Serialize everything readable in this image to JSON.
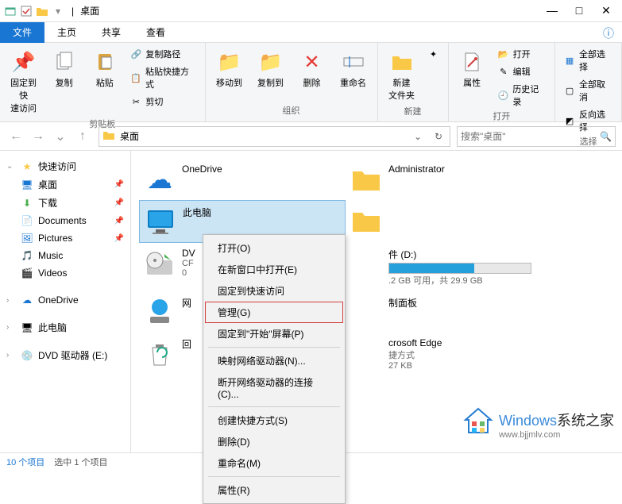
{
  "titlebar": {
    "separator": "|",
    "title": "桌面"
  },
  "win": {
    "min": "—",
    "max": "□",
    "close": "✕"
  },
  "tabs": {
    "file": "文件",
    "home": "主页",
    "share": "共享",
    "view": "查看"
  },
  "ribbon": {
    "clipboard": {
      "pin": "固定到快\n速访问",
      "copy": "复制",
      "paste": "粘贴",
      "copy_path": "复制路径",
      "paste_shortcut": "粘贴快捷方式",
      "cut": "剪切",
      "label": "剪贴板"
    },
    "organize": {
      "move": "移动到",
      "copy_to": "复制到",
      "delete": "删除",
      "rename": "重命名",
      "label": "组织"
    },
    "new": {
      "new_folder": "新建\n文件夹",
      "label": "新建"
    },
    "open": {
      "properties": "属性",
      "open": "打开",
      "edit": "编辑",
      "history": "历史记录",
      "label": "打开"
    },
    "select": {
      "select_all": "全部选择",
      "select_none": "全部取消",
      "invert": "反向选择",
      "label": "选择"
    }
  },
  "address": {
    "location": "桌面"
  },
  "search": {
    "placeholder": "搜索\"桌面\""
  },
  "sidebar": {
    "quick_access": "快速访问",
    "desktop": "桌面",
    "downloads": "下载",
    "documents": "Documents",
    "pictures": "Pictures",
    "music": "Music",
    "videos": "Videos",
    "onedrive": "OneDrive",
    "this_pc": "此电脑",
    "dvd": "DVD 驱动器 (E:)"
  },
  "items": {
    "onedrive": "OneDrive",
    "admin": "Administrator",
    "this_pc": "此电脑",
    "dvd1": "DV",
    "dvd2": "CF",
    "dvd3": "0",
    "disk_name": "件 (D:)",
    "disk_sub": ".2 GB 可用，共 29.9 GB",
    "network": "网",
    "panel_name": "制面板",
    "recycle": "回",
    "edge_name": "crosoft Edge",
    "edge_sub1": "捷方式",
    "edge_sub2": "27 KB"
  },
  "context": {
    "open": "打开(O)",
    "open_new": "在新窗口中打开(E)",
    "pin_quick": "固定到快速访问",
    "manage": "管理(G)",
    "pin_start": "固定到\"开始\"屏幕(P)",
    "map_drive": "映射网络驱动器(N)...",
    "disconnect": "断开网络驱动器的连接(C)...",
    "shortcut": "创建快捷方式(S)",
    "delete": "删除(D)",
    "rename": "重命名(M)",
    "properties": "属性(R)"
  },
  "status": {
    "count": "10 个项目",
    "selected": "选中 1 个项目"
  },
  "watermark": {
    "brand_prefix": "Windows",
    "brand_suffix": "系统之家",
    "url": "www.bjjmlv.com"
  }
}
